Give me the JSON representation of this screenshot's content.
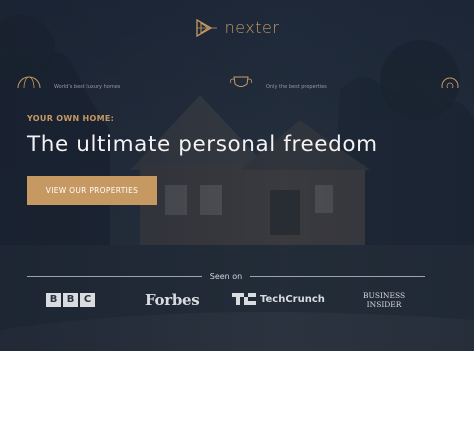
{
  "brand": {
    "name": "nexter",
    "accent": "#c69963"
  },
  "hero": {
    "subheading": "YOUR OWN HOME:",
    "heading": "The ultimate personal freedom",
    "cta_label": "VIEW OUR PROPERTIES"
  },
  "seen_on": {
    "label": "Seen on",
    "outlets": {
      "bbc": [
        "B",
        "B",
        "C"
      ],
      "forbes": "Forbes",
      "techcrunch": "TechCrunch",
      "business_insider_line1": "BUSINESS",
      "business_insider_line2": "INSIDER"
    }
  },
  "features": {
    "left_text": "World's best luxury homes",
    "right_text": "Only the best properties"
  }
}
